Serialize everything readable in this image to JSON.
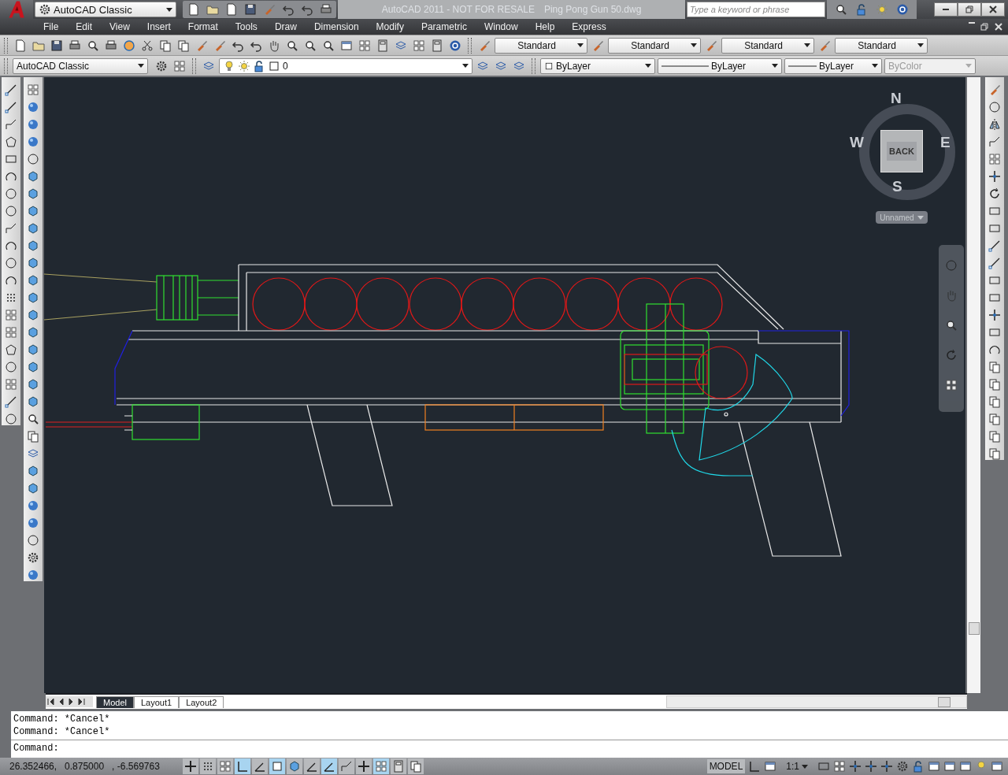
{
  "title_bar": {
    "workspace": "AutoCAD Classic",
    "product": "AutoCAD 2011 - NOT FOR RESALE",
    "document": "Ping Pong Gun 50.dwg",
    "search": {
      "placeholder": "Type a keyword or phrase"
    }
  },
  "menu": [
    "File",
    "Edit",
    "View",
    "Insert",
    "Format",
    "Tools",
    "Draw",
    "Dimension",
    "Modify",
    "Parametric",
    "Window",
    "Help",
    "Express"
  ],
  "style_toolbar": [
    "Standard",
    "Standard",
    "Standard",
    "Standard"
  ],
  "workspace_toolbar": {
    "workspace": "AutoCAD Classic",
    "layer": "0"
  },
  "properties_toolbar": [
    {
      "kind": "color",
      "value": "ByLayer",
      "disabled": false
    },
    {
      "kind": "linetype",
      "value": "ByLayer",
      "disabled": false
    },
    {
      "kind": "lineweight",
      "value": "ByLayer",
      "disabled": false
    },
    {
      "kind": "plot",
      "value": "ByColor",
      "disabled": true
    }
  ],
  "viewcube": {
    "north": "N",
    "east": "E",
    "south": "S",
    "west": "W",
    "face": "BACK",
    "ucs": "Unnamed"
  },
  "layout_tabs": [
    {
      "label": "Model",
      "selected": true
    },
    {
      "label": "Layout1",
      "selected": false
    },
    {
      "label": "Layout2",
      "selected": false
    }
  ],
  "command_history": [
    "Command: *Cancel*",
    "Command: *Cancel*"
  ],
  "command_prompt": "Command:",
  "status_bar": {
    "coordinates": "26.352466,   0.875000   , -6.569763",
    "toggles": [
      {
        "on": false
      },
      {
        "on": false
      },
      {
        "on": false
      },
      {
        "on": true
      },
      {
        "on": false
      },
      {
        "on": true
      },
      {
        "on": false
      },
      {
        "on": false
      },
      {
        "on": true
      },
      {
        "on": false
      },
      {
        "on": false
      },
      {
        "on": true
      },
      {
        "on": false
      },
      {
        "on": false
      }
    ],
    "space": "MODEL",
    "annotation_scale": "1:1"
  }
}
